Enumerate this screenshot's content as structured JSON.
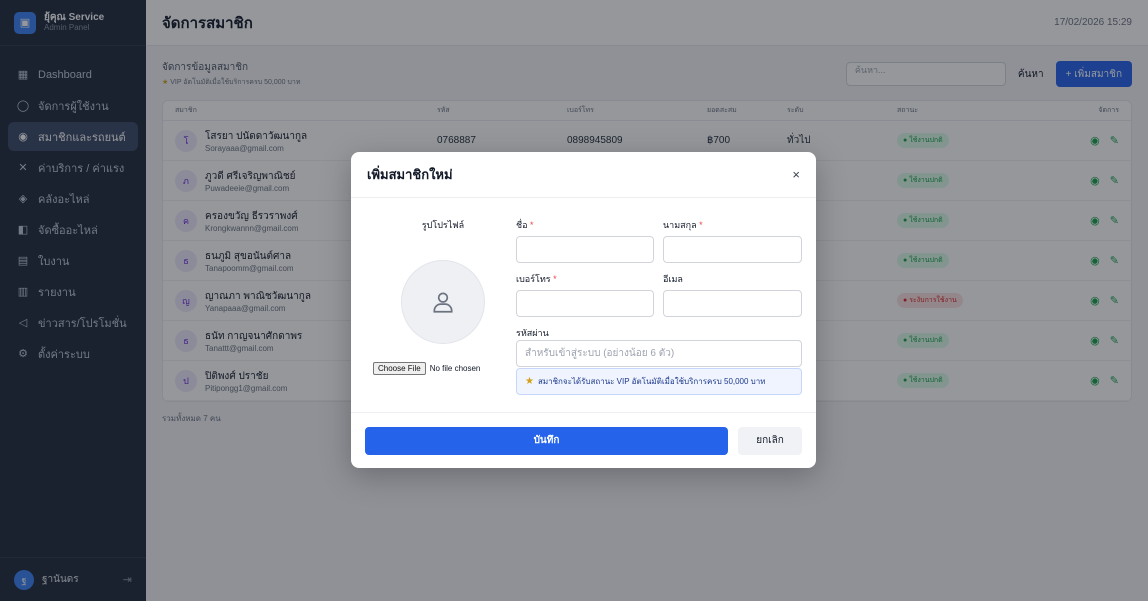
{
  "brand": {
    "name": "ยุ้คุณ Service",
    "subtitle": "Admin Panel",
    "logo_icon": "building-icon"
  },
  "sidebar": {
    "items": [
      {
        "label": "Dashboard",
        "icon": "grid-icon"
      },
      {
        "label": "จัดการผู้ใช้งาน",
        "icon": "user-icon"
      },
      {
        "label": "สมาชิกและรถยนต์",
        "icon": "users-icon",
        "active": true
      },
      {
        "label": "ค่าบริการ / ค่าแรง",
        "icon": "tool-icon"
      },
      {
        "label": "คลังอะไหล่",
        "icon": "box-icon"
      },
      {
        "label": "จัดซื้ออะไหล่",
        "icon": "cart-icon"
      },
      {
        "label": "ใบงาน",
        "icon": "clipboard-icon"
      },
      {
        "label": "รายงาน",
        "icon": "chart-icon"
      },
      {
        "label": "ข่าวสาร/โปรโมชั่น",
        "icon": "megaphone-icon"
      },
      {
        "label": "ตั้งค่าระบบ",
        "icon": "gear-icon"
      }
    ],
    "footer_user_initial": "ฐ",
    "footer_user": "ฐานันดร"
  },
  "header": {
    "title": "จัดการสมาชิก",
    "datetime": "17/02/2026 15:29"
  },
  "toolbar": {
    "subtitle": "จัดการข้อมูลสมาชิก",
    "vip_note": "VIP อัตโนมัติเมื่อใช้บริการครบ 50,000 บาท",
    "search_placeholder": "ค้นหา...",
    "search_label": "ค้นหา",
    "add_label": "+ เพิ่มสมาชิก"
  },
  "table": {
    "headers": [
      "สมาชิก",
      "รหัส",
      "เบอร์โทร",
      "ยอดสะสม",
      "ระดับ",
      "สถานะ",
      "จัดการ"
    ],
    "rows": [
      {
        "initial": "โ",
        "name": "โสรยา ปนัดดาวัฒนากูล",
        "email": "Sorayaaa@gmail.com",
        "code": "0768887",
        "phone": "0898945809",
        "total": "฿700",
        "level": "ทั่วไป",
        "status": "ใช้งานปกติ",
        "active": true
      },
      {
        "initial": "ภ",
        "name": "ภูวดี ศรีเจริญพาณิชย์",
        "email": "Puwadeeie@gmail.com",
        "status": "ใช้งานปกติ",
        "active": true
      },
      {
        "initial": "ค",
        "name": "ครองขวัญ ธีรวราพงศ์",
        "email": "Krongkwannn@gmail.com",
        "status": "ใช้งานปกติ",
        "active": true
      },
      {
        "initial": "ธ",
        "name": "ธนภูมิ สุขอนันต์ศาล",
        "email": "Tanapoomm@gmail.com",
        "status": "ใช้งานปกติ",
        "active": true
      },
      {
        "initial": "ญ",
        "name": "ญาณภา พาณิชวัฒนากูล",
        "email": "Yanapaaa@gmail.com",
        "status": "ระงับการใช้งาน",
        "active": false
      },
      {
        "initial": "ธ",
        "name": "ธนัท กาญจนาศักดาพร",
        "email": "Tanattt@gmail.com",
        "status": "ใช้งานปกติ",
        "active": true
      },
      {
        "initial": "ป",
        "name": "ปิติพงศ์ ปราชัย",
        "email": "Pitipongg1@gmail.com",
        "status": "ใช้งานปกติ",
        "active": true
      }
    ],
    "total_text": "รวมทั้งหมด 7 คน"
  },
  "modal": {
    "title": "เพิ่มสมาชิกใหม่",
    "close": "×",
    "picture_label": "รูปโปรไฟล์",
    "file_button": "Choose File",
    "file_status": "No file chosen",
    "first_name_label": "ชื่อ",
    "last_name_label": "นามสกุล",
    "phone_label": "เบอร์โทร",
    "email_label": "อีเมล",
    "required_mark": "*",
    "password_label": "รหัสผ่าน",
    "password_placeholder": "สำหรับเข้าสู่ระบบ (อย่างน้อย 6 ตัว)",
    "vip_info": "สมาชิกจะได้รับสถานะ VIP อัตโนมัติเมื่อใช้บริการครบ 50,000 บาท",
    "save_label": "บันทึก",
    "cancel_label": "ยกเลิก"
  }
}
